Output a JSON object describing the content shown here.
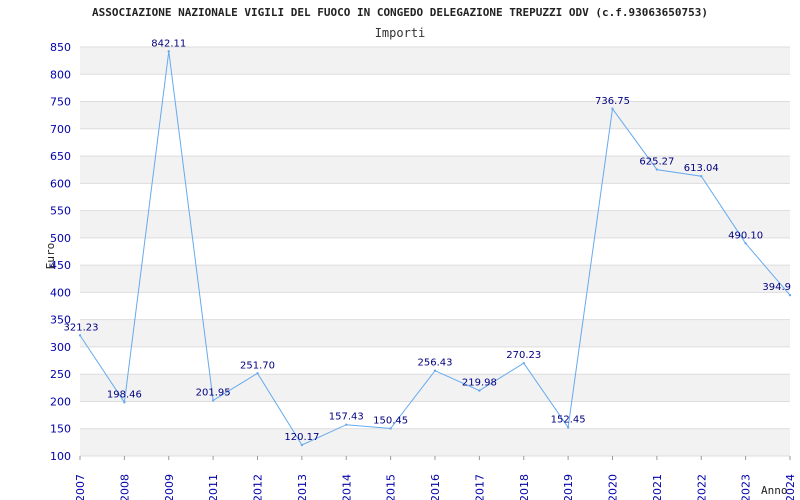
{
  "chart_data": {
    "type": "line",
    "title": "ASSOCIAZIONE NAZIONALE VIGILI DEL FUOCO IN CONGEDO DELEGAZIONE TREPUZZI ODV (c.f.93063650753)",
    "subtitle": "Importi",
    "xlabel": "Anno",
    "ylabel": "Euro",
    "categories": [
      "2007",
      "2008",
      "2009",
      "2011",
      "2012",
      "2013",
      "2014",
      "2015",
      "2016",
      "2017",
      "2018",
      "2019",
      "2020",
      "2021",
      "2022",
      "2023",
      "2024"
    ],
    "series": [
      {
        "values": [
          321.23,
          198.46,
          842.11,
          201.95,
          251.7,
          120.17,
          157.43,
          150.45,
          256.43,
          219.98,
          270.23,
          152.45,
          736.75,
          625.27,
          613.04,
          490.1,
          394.9
        ],
        "labels": [
          "321.23",
          "198.46",
          "842.11",
          "201.95",
          "251.70",
          "120.17",
          "157.43",
          "150.45",
          "256.43",
          "219.98",
          "270.23",
          "152.45",
          "736.75",
          "625.27",
          "613.04",
          "490.10",
          "394.9"
        ]
      }
    ],
    "ylim": [
      100,
      850
    ],
    "yticks": [
      100,
      150,
      200,
      250,
      300,
      350,
      400,
      450,
      500,
      550,
      600,
      650,
      700,
      750,
      800,
      850
    ],
    "grid": true,
    "colors": {
      "line": "#66aaee",
      "band_light": "#f2f2f2",
      "band_white": "#ffffff",
      "gridline": "#dddddd",
      "tick_text": "#0000aa",
      "label_text": "#000080"
    }
  }
}
